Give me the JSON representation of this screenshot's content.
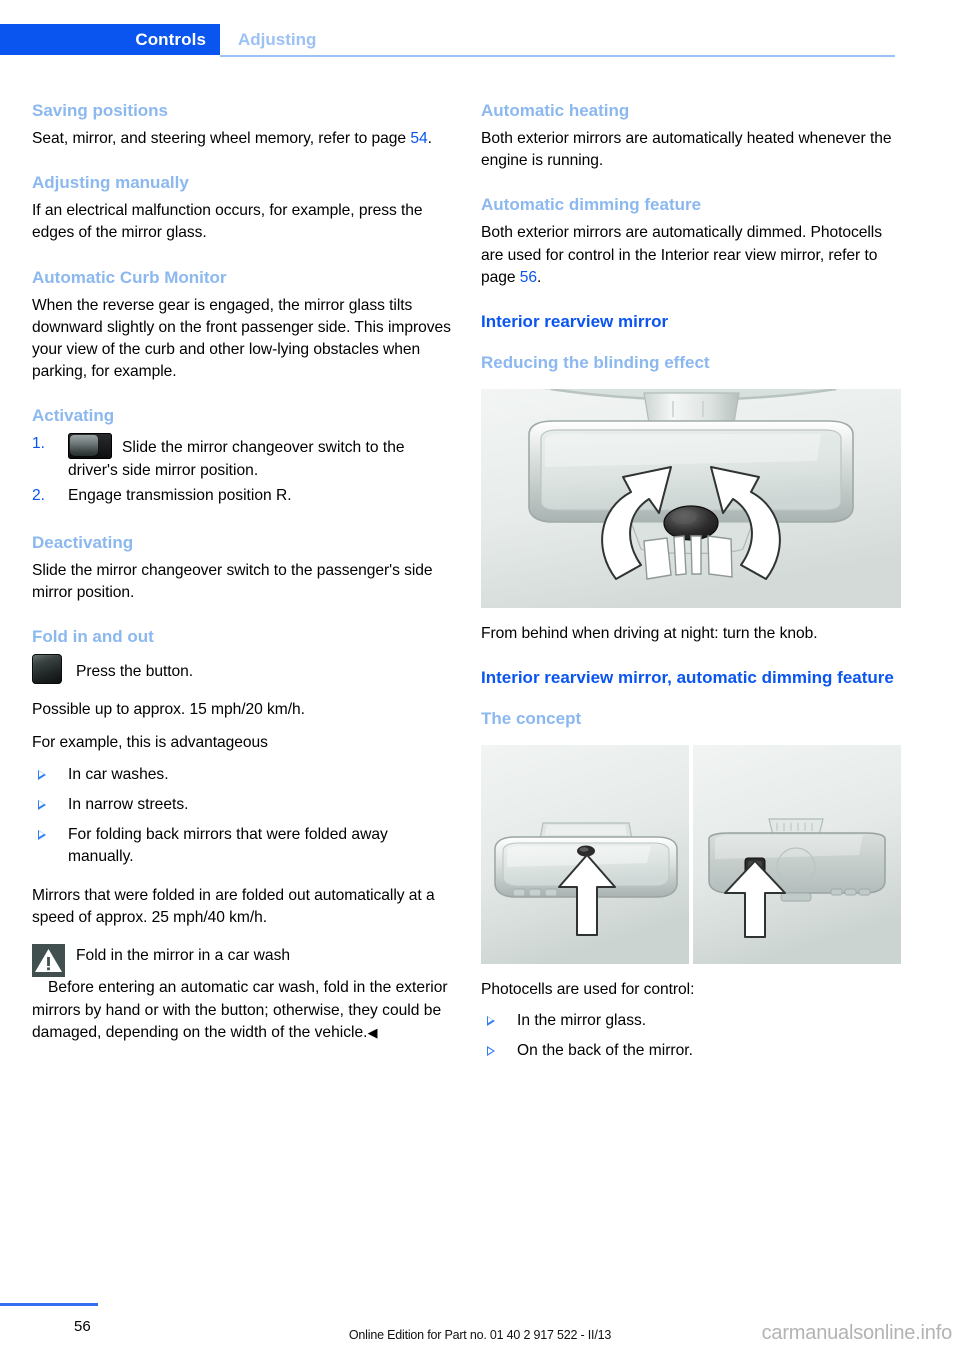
{
  "header": {
    "tab_label": "Controls",
    "section_label": "Adjusting"
  },
  "left_column": {
    "h_saving_positions": "Saving positions",
    "saving_positions_text_a": "Seat, mirror, and steering wheel memory, refer to page ",
    "saving_positions_page_ref": "54",
    "saving_positions_text_b": ".",
    "h_adjusting_manually": "Adjusting manually",
    "adjusting_manually_text": "If an electrical malfunction occurs, for example, press the edges of the mirror glass.",
    "h_automatic_curb_monitor": "Automatic Curb Monitor",
    "automatic_curb_monitor_text": "When the reverse gear is engaged, the mirror glass tilts downward slightly on the front passenger side. This improves your view of the curb and other low-lying obstacles when parking, for example.",
    "h_activating": "Activating",
    "step_1_num": "1.",
    "step_1_text": "Slide the mirror changeover switch to the driver's side mirror position.",
    "step_2_num": "2.",
    "step_2_text": "Engage transmission position R.",
    "h_deactivating": "Deactivating",
    "deactivating_text": "Slide the mirror changeover switch to the passenger's side mirror position.",
    "h_fold_in_and_out": "Fold in and out",
    "press_button_text": "Press the button.",
    "possible_speed_text": "Possible up to approx. 15 mph/20 km/h.",
    "for_example_text": "For example, this is advantageous",
    "bullets": [
      "In car washes.",
      "In narrow streets.",
      "For folding back mirrors that were folded away manually."
    ],
    "mirrors_folded_text": "Mirrors that were folded in are folded out automatically at a speed of approx. 25 mph/40 km/h.",
    "warning_title": "Fold in the mirror in a car wash",
    "warning_text": "Before entering an automatic car wash, fold in the exterior mirrors by hand or with the button; otherwise, they could be damaged, depending on the width of the vehicle.",
    "warning_end_mark": "◀"
  },
  "right_column": {
    "h_automatic_heating": "Automatic heating",
    "automatic_heating_text": "Both exterior mirrors are automatically heated whenever the engine is running.",
    "h_automatic_dimming": "Automatic dimming feature",
    "automatic_dimming_text_a": "Both exterior mirrors are automatically dimmed. Photocells are used for control in the Interior rear view mirror, refer to page ",
    "automatic_dimming_page_ref": "56",
    "automatic_dimming_text_b": ".",
    "h_interior_rearview_mirror": "Interior rearview mirror",
    "h_reducing_blinding": "Reducing the blinding effect",
    "figure_1_caption": "From behind when driving at night: turn the knob.",
    "h_interior_rearview_auto": "Interior rearview mirror, automatic dimming feature",
    "h_the_concept": "The concept",
    "photocells_intro": "Photocells are used for control:",
    "photocell_bullets": [
      "In the mirror glass.",
      "On the back of the mirror."
    ]
  },
  "footer": {
    "page_number": "56",
    "edition_note": "Online Edition for Part no. 01 40 2 917 522 - II/13",
    "watermark": "carmanualsonline.info"
  },
  "colors": {
    "tab_blue": "#0a55ef",
    "heading_major_blue": "#0a55ef",
    "heading_minor_blue": "#8cb8f0",
    "header_section_blue": "#9cc1f5",
    "bullet_blue": "#2f7df6",
    "warning_icon_gray": "#424f4f",
    "watermark_gray": "#b3b3b3"
  }
}
